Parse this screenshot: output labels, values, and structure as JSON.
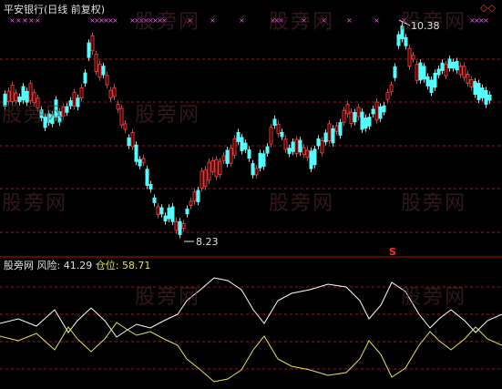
{
  "header": {
    "title": "平安银行(日线 前复权)"
  },
  "price_panel": {
    "high_label": "10.38",
    "low_label": "8.23",
    "signal_marker": "S",
    "corner_marker": "◇◇"
  },
  "indicator_panel": {
    "name": "股旁网",
    "risk_label": "风险:",
    "risk_value": "41.29",
    "position_label": "仓位:",
    "position_value": "58.71"
  },
  "watermarks": [
    "股旁网",
    "股旁网",
    "股旁网",
    "股旁网",
    "股旁网",
    "股旁网",
    "股旁网",
    "股旁网",
    "股旁网",
    "股旁网"
  ],
  "colors": {
    "background": "#000000",
    "up_candle": "#ff3030",
    "down_candle": "#54ffff",
    "grid": "#8b1e1e",
    "risk_line": "#ffffff",
    "position_line": "#e8e060",
    "cross_marker": "#ff50ff",
    "separator": "#b01010"
  }
}
